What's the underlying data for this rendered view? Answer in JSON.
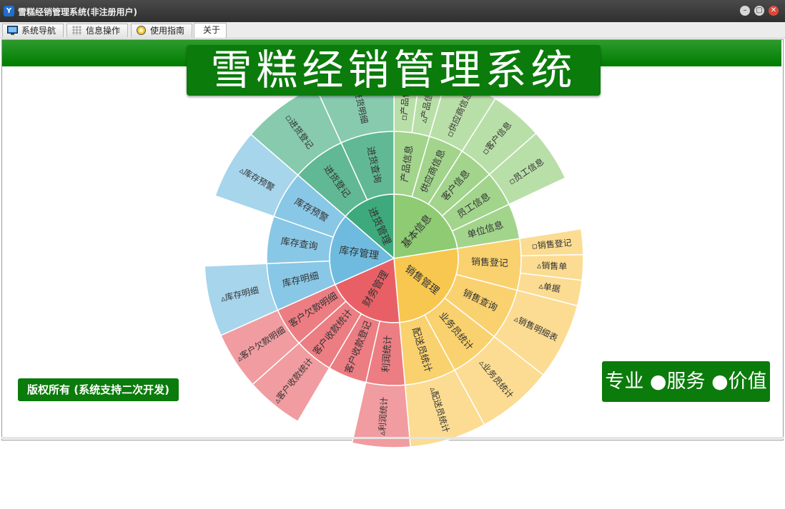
{
  "window": {
    "title": "雪糕经销管理系统(非注册用户)",
    "app_icon_glyph": "Y",
    "min_glyph": "–",
    "max_glyph": "▢",
    "close_glyph": "✕"
  },
  "tabs": [
    {
      "label": "系统导航",
      "icon": "monitor-icon"
    },
    {
      "label": "信息操作",
      "icon": "grid-icon"
    },
    {
      "label": "使用指南",
      "icon": "help-icon"
    },
    {
      "label": "关于",
      "icon": ""
    }
  ],
  "banner": {
    "title": "雪糕经销管理系统"
  },
  "copyright": "版权所有 (系统支持二次开发)",
  "slogan": "专业 ●服务 ●价值",
  "colors": {
    "accent_green": "#0b7b0b",
    "basic_info": "#8ecb73",
    "sales": "#f8c74f",
    "finance": "#e86066",
    "inventory": "#6fbbe0",
    "purchase": "#3ea97c"
  },
  "sunburst": {
    "categories": [
      {
        "name": "基本信息",
        "subs": [
          {
            "name": "产品信息",
            "leaves": [
              "▫产品信息",
              "▵产品信息"
            ]
          },
          {
            "name": "供应商信息",
            "leaves": [
              "▫供应商信息"
            ]
          },
          {
            "name": "客户信息",
            "leaves": [
              "▫客户信息"
            ]
          },
          {
            "name": "员工信息",
            "leaves": [
              "▫员工信息"
            ]
          },
          {
            "name": "单位信息",
            "leaves": []
          }
        ]
      },
      {
        "name": "销售管理",
        "subs": [
          {
            "name": "销售登记",
            "leaves": [
              "▫销售登记",
              "▵销售单",
              "▵单据"
            ]
          },
          {
            "name": "销售查询",
            "leaves": [
              "▵销售明细表"
            ]
          },
          {
            "name": "业务员统计",
            "leaves": [
              "▵业务员统计"
            ]
          },
          {
            "name": "配送员统计",
            "leaves": [
              "▵配送员统计"
            ]
          }
        ]
      },
      {
        "name": "财务管理",
        "subs": [
          {
            "name": "利润统计",
            "leaves": [
              "▵利润统计"
            ]
          },
          {
            "name": "客户收款登记",
            "leaves": []
          },
          {
            "name": "客户收款统计",
            "leaves": [
              "▵客户收款统计"
            ]
          },
          {
            "name": "客户欠款明细",
            "leaves": [
              "▵客户欠款明细"
            ]
          }
        ]
      },
      {
        "name": "库存管理",
        "subs": [
          {
            "name": "库存明细",
            "leaves": [
              "▵库存明细"
            ]
          },
          {
            "name": "库存查询",
            "leaves": []
          },
          {
            "name": "库存预警",
            "leaves": [
              "▵库存预警"
            ]
          }
        ]
      },
      {
        "name": "进货管理",
        "subs": [
          {
            "name": "进货登记",
            "leaves": [
              "▫进货登记"
            ]
          },
          {
            "name": "进货查询",
            "leaves": [
              "▫进货明细"
            ]
          }
        ]
      }
    ]
  }
}
